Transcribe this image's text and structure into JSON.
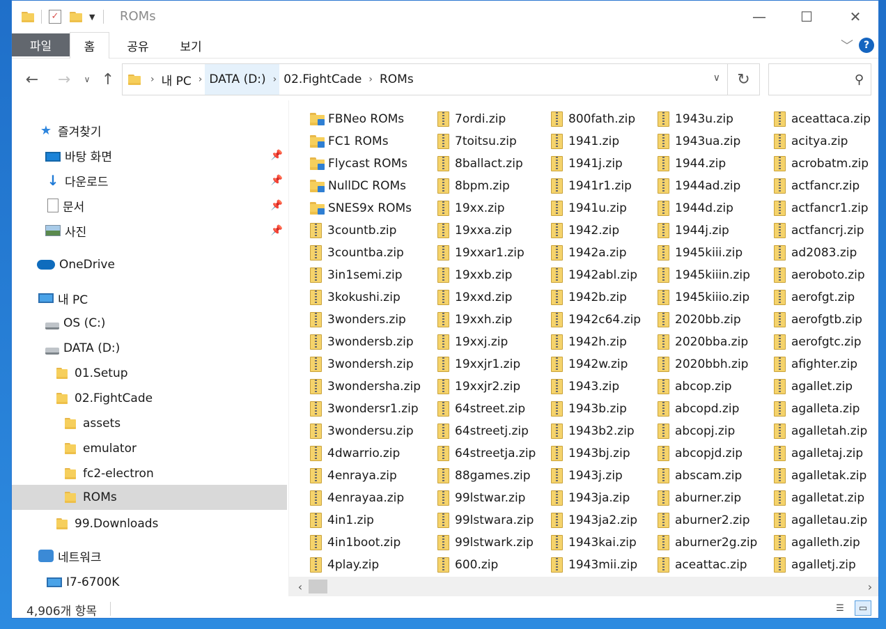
{
  "window": {
    "title": "ROMs"
  },
  "titlebar_buttons": {
    "minimize": "—",
    "maximize": "☐",
    "close": "✕"
  },
  "ribbon": {
    "file": "파일",
    "home": "홈",
    "share": "공유",
    "view": "보기",
    "help": "?"
  },
  "address": {
    "crumbs": [
      "내 PC",
      "DATA (D:)",
      "02.FightCade",
      "ROMs"
    ],
    "search_placeholder": ""
  },
  "nav": {
    "quick_access": "즐겨찾기",
    "desktop": "바탕 화면",
    "downloads": "다운로드",
    "documents": "문서",
    "pictures": "사진",
    "onedrive": "OneDrive",
    "this_pc": "내 PC",
    "c_drive": "OS (C:)",
    "d_drive": "DATA (D:)",
    "setup": "01.Setup",
    "fightcade": "02.FightCade",
    "assets": "assets",
    "emulator": "emulator",
    "fc2": "fc2-electron",
    "roms": "ROMs",
    "downloads_folder": "99.Downloads",
    "network": "네트워크",
    "computer": "I7-6700K"
  },
  "files": {
    "col1": [
      "FBNeo ROMs",
      "FC1 ROMs",
      "Flycast ROMs",
      "NullDC ROMs",
      "SNES9x ROMs",
      "3countb.zip",
      "3countba.zip",
      "3in1semi.zip",
      "3kokushi.zip",
      "3wonders.zip",
      "3wondersb.zip",
      "3wondersh.zip",
      "3wondersha.zip",
      "3wondersr1.zip",
      "3wondersu.zip",
      "4dwarrio.zip",
      "4enraya.zip",
      "4enrayaa.zip",
      "4in1.zip",
      "4in1boot.zip",
      "4play.zip"
    ],
    "col2": [
      "7ordi.zip",
      "7toitsu.zip",
      "8ballact.zip",
      "8bpm.zip",
      "19xx.zip",
      "19xxa.zip",
      "19xxar1.zip",
      "19xxb.zip",
      "19xxd.zip",
      "19xxh.zip",
      "19xxj.zip",
      "19xxjr1.zip",
      "19xxjr2.zip",
      "64street.zip",
      "64streetj.zip",
      "64streetja.zip",
      "88games.zip",
      "99lstwar.zip",
      "99lstwara.zip",
      "99lstwark.zip",
      "600.zip"
    ],
    "col3": [
      "800fath.zip",
      "1941.zip",
      "1941j.zip",
      "1941r1.zip",
      "1941u.zip",
      "1942.zip",
      "1942a.zip",
      "1942abl.zip",
      "1942b.zip",
      "1942c64.zip",
      "1942h.zip",
      "1942w.zip",
      "1943.zip",
      "1943b.zip",
      "1943b2.zip",
      "1943bj.zip",
      "1943j.zip",
      "1943ja.zip",
      "1943ja2.zip",
      "1943kai.zip",
      "1943mii.zip"
    ],
    "col4": [
      "1943u.zip",
      "1943ua.zip",
      "1944.zip",
      "1944ad.zip",
      "1944d.zip",
      "1944j.zip",
      "1945kiii.zip",
      "1945kiiin.zip",
      "1945kiiio.zip",
      "2020bb.zip",
      "2020bba.zip",
      "2020bbh.zip",
      "abcop.zip",
      "abcopd.zip",
      "abcopj.zip",
      "abcopjd.zip",
      "abscam.zip",
      "aburner.zip",
      "aburner2.zip",
      "aburner2g.zip",
      "aceattac.zip"
    ],
    "col5": [
      "aceattaca.zip",
      "acitya.zip",
      "acrobatm.zip",
      "actfancr.zip",
      "actfancr1.zip",
      "actfancrj.zip",
      "ad2083.zip",
      "aeroboto.zip",
      "aerofgt.zip",
      "aerofgtb.zip",
      "aerofgtc.zip",
      "afighter.zip",
      "agallet.zip",
      "agalleta.zip",
      "agalletah.zip",
      "agalletaj.zip",
      "agalletak.zip",
      "agalletat.zip",
      "agalletau.zip",
      "agalleth.zip",
      "agalletj.zip"
    ]
  },
  "status": {
    "count": "4,906개 항목"
  }
}
